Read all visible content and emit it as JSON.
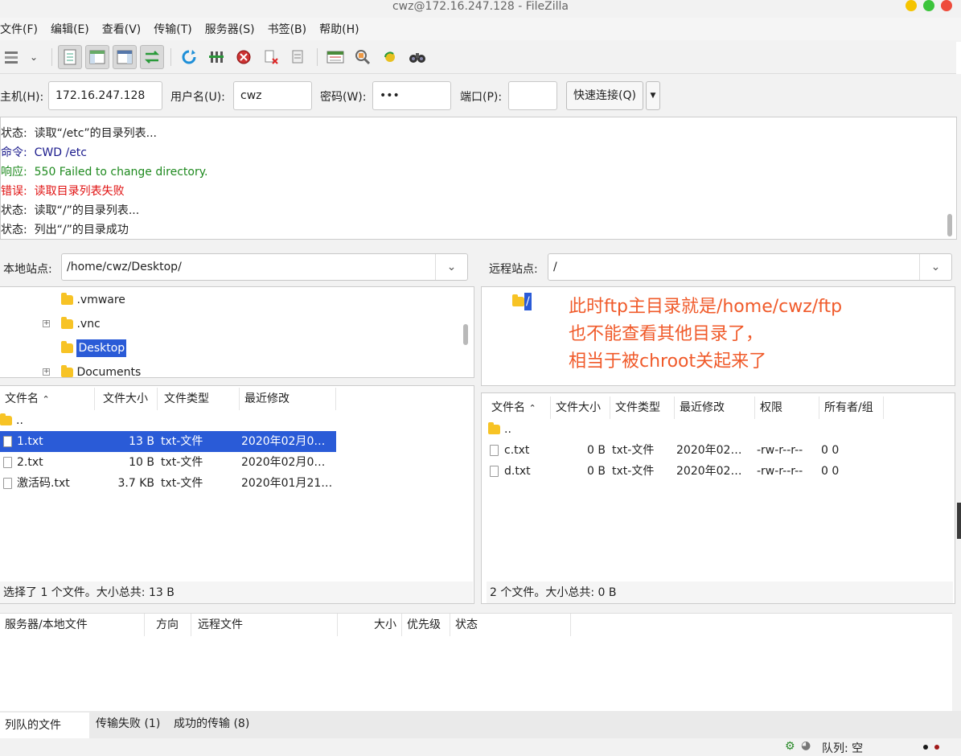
{
  "window": {
    "title": "cwz@172.16.247.128 - FileZilla"
  },
  "menu": [
    "文件(F)",
    "编辑(E)",
    "查看(V)",
    "传输(T)",
    "服务器(S)",
    "书签(B)",
    "帮助(H)"
  ],
  "quickconnect": {
    "host_label": "主机(H):",
    "host_value": "172.16.247.128",
    "user_label": "用户名(U):",
    "user_value": "cwz",
    "pass_label": "密码(W):",
    "pass_value": "•••",
    "port_label": "端口(P):",
    "port_value": "",
    "button_label": "快速连接(Q)"
  },
  "log": [
    {
      "type": "状态:",
      "text": "读取“/etc”的目录列表...",
      "color": "#222222"
    },
    {
      "type": "命令:",
      "text": "CWD /etc",
      "color": "#1a1a8c"
    },
    {
      "type": "响应:",
      "text": "550 Failed to change directory.",
      "color": "#1f8a1f"
    },
    {
      "type": "错误:",
      "text": "读取目录列表失败",
      "color": "#e01010"
    },
    {
      "type": "状态:",
      "text": "读取“/”的目录列表...",
      "color": "#222222"
    },
    {
      "type": "状态:",
      "text": "列出“/”的目录成功",
      "color": "#222222"
    }
  ],
  "local": {
    "site_label": "本地站点:",
    "path": "/home/cwz/Desktop/",
    "tree": [
      ".vmware",
      ".vnc",
      "Desktop",
      "Documents"
    ],
    "headers": [
      "文件名",
      "文件大小",
      "文件类型",
      "最近修改"
    ],
    "parent": "..",
    "files": [
      {
        "name": "1.txt",
        "size": "13 B",
        "type": "txt-文件",
        "modified": "2020年02月0…"
      },
      {
        "name": "2.txt",
        "size": "10 B",
        "type": "txt-文件",
        "modified": "2020年02月0…"
      },
      {
        "name": "激活码.txt",
        "size": "3.7 KB",
        "type": "txt-文件",
        "modified": "2020年01月21…"
      }
    ],
    "status": "选择了 1 个文件。大小总共: 13 B"
  },
  "remote": {
    "site_label": "远程站点:",
    "path": "/",
    "tree": [
      "/"
    ],
    "annotation": [
      "此时ftp主目录就是/home/cwz/ftp",
      "也不能查看其他目录了，",
      "相当于被chroot关起来了"
    ],
    "headers": [
      "文件名",
      "文件大小",
      "文件类型",
      "最近修改",
      "权限",
      "所有者/组"
    ],
    "parent": "..",
    "files": [
      {
        "name": "c.txt",
        "size": "0 B",
        "type": "txt-文件",
        "modified": "2020年02…",
        "perms": "-rw-r--r--",
        "owner": "0 0"
      },
      {
        "name": "d.txt",
        "size": "0 B",
        "type": "txt-文件",
        "modified": "2020年02…",
        "perms": "-rw-r--r--",
        "owner": "0 0"
      }
    ],
    "status": "2 个文件。大小总共: 0 B"
  },
  "queue": {
    "headers": [
      "服务器/本地文件",
      "方向",
      "远程文件",
      "大小",
      "优先级",
      "状态"
    ],
    "tabs": [
      "列队的文件",
      "传输失败 (1)",
      "成功的传输 (8)"
    ],
    "status": "队列: 空"
  },
  "colors": {
    "selection": "#2a5bd7",
    "annotation": "#f05a2a",
    "folder": "#f7c325"
  }
}
